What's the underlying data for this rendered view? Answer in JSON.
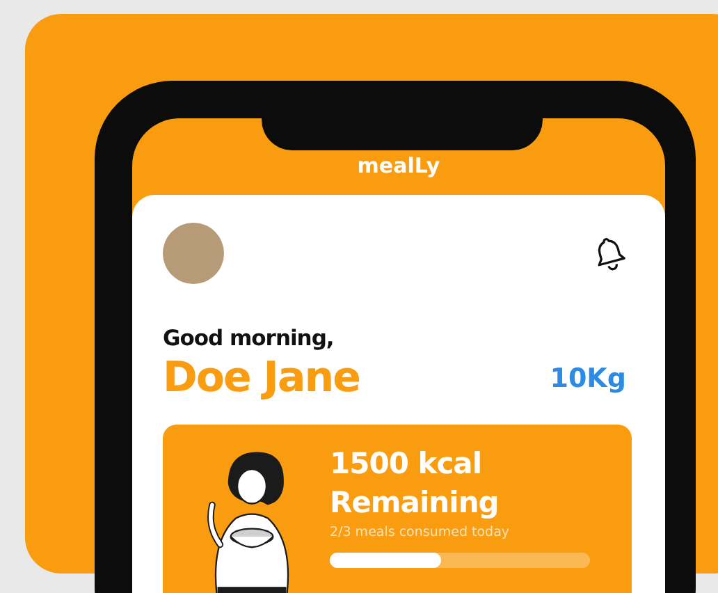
{
  "app": {
    "logo": "mealLy"
  },
  "greeting": "Good morning,",
  "user": {
    "name": "Doe Jane",
    "weight": "10Kg"
  },
  "summary": {
    "calories": "1500 kcal",
    "label": "Remaining",
    "meals": "2/3 meals consumed today",
    "level": 0.43
  }
}
